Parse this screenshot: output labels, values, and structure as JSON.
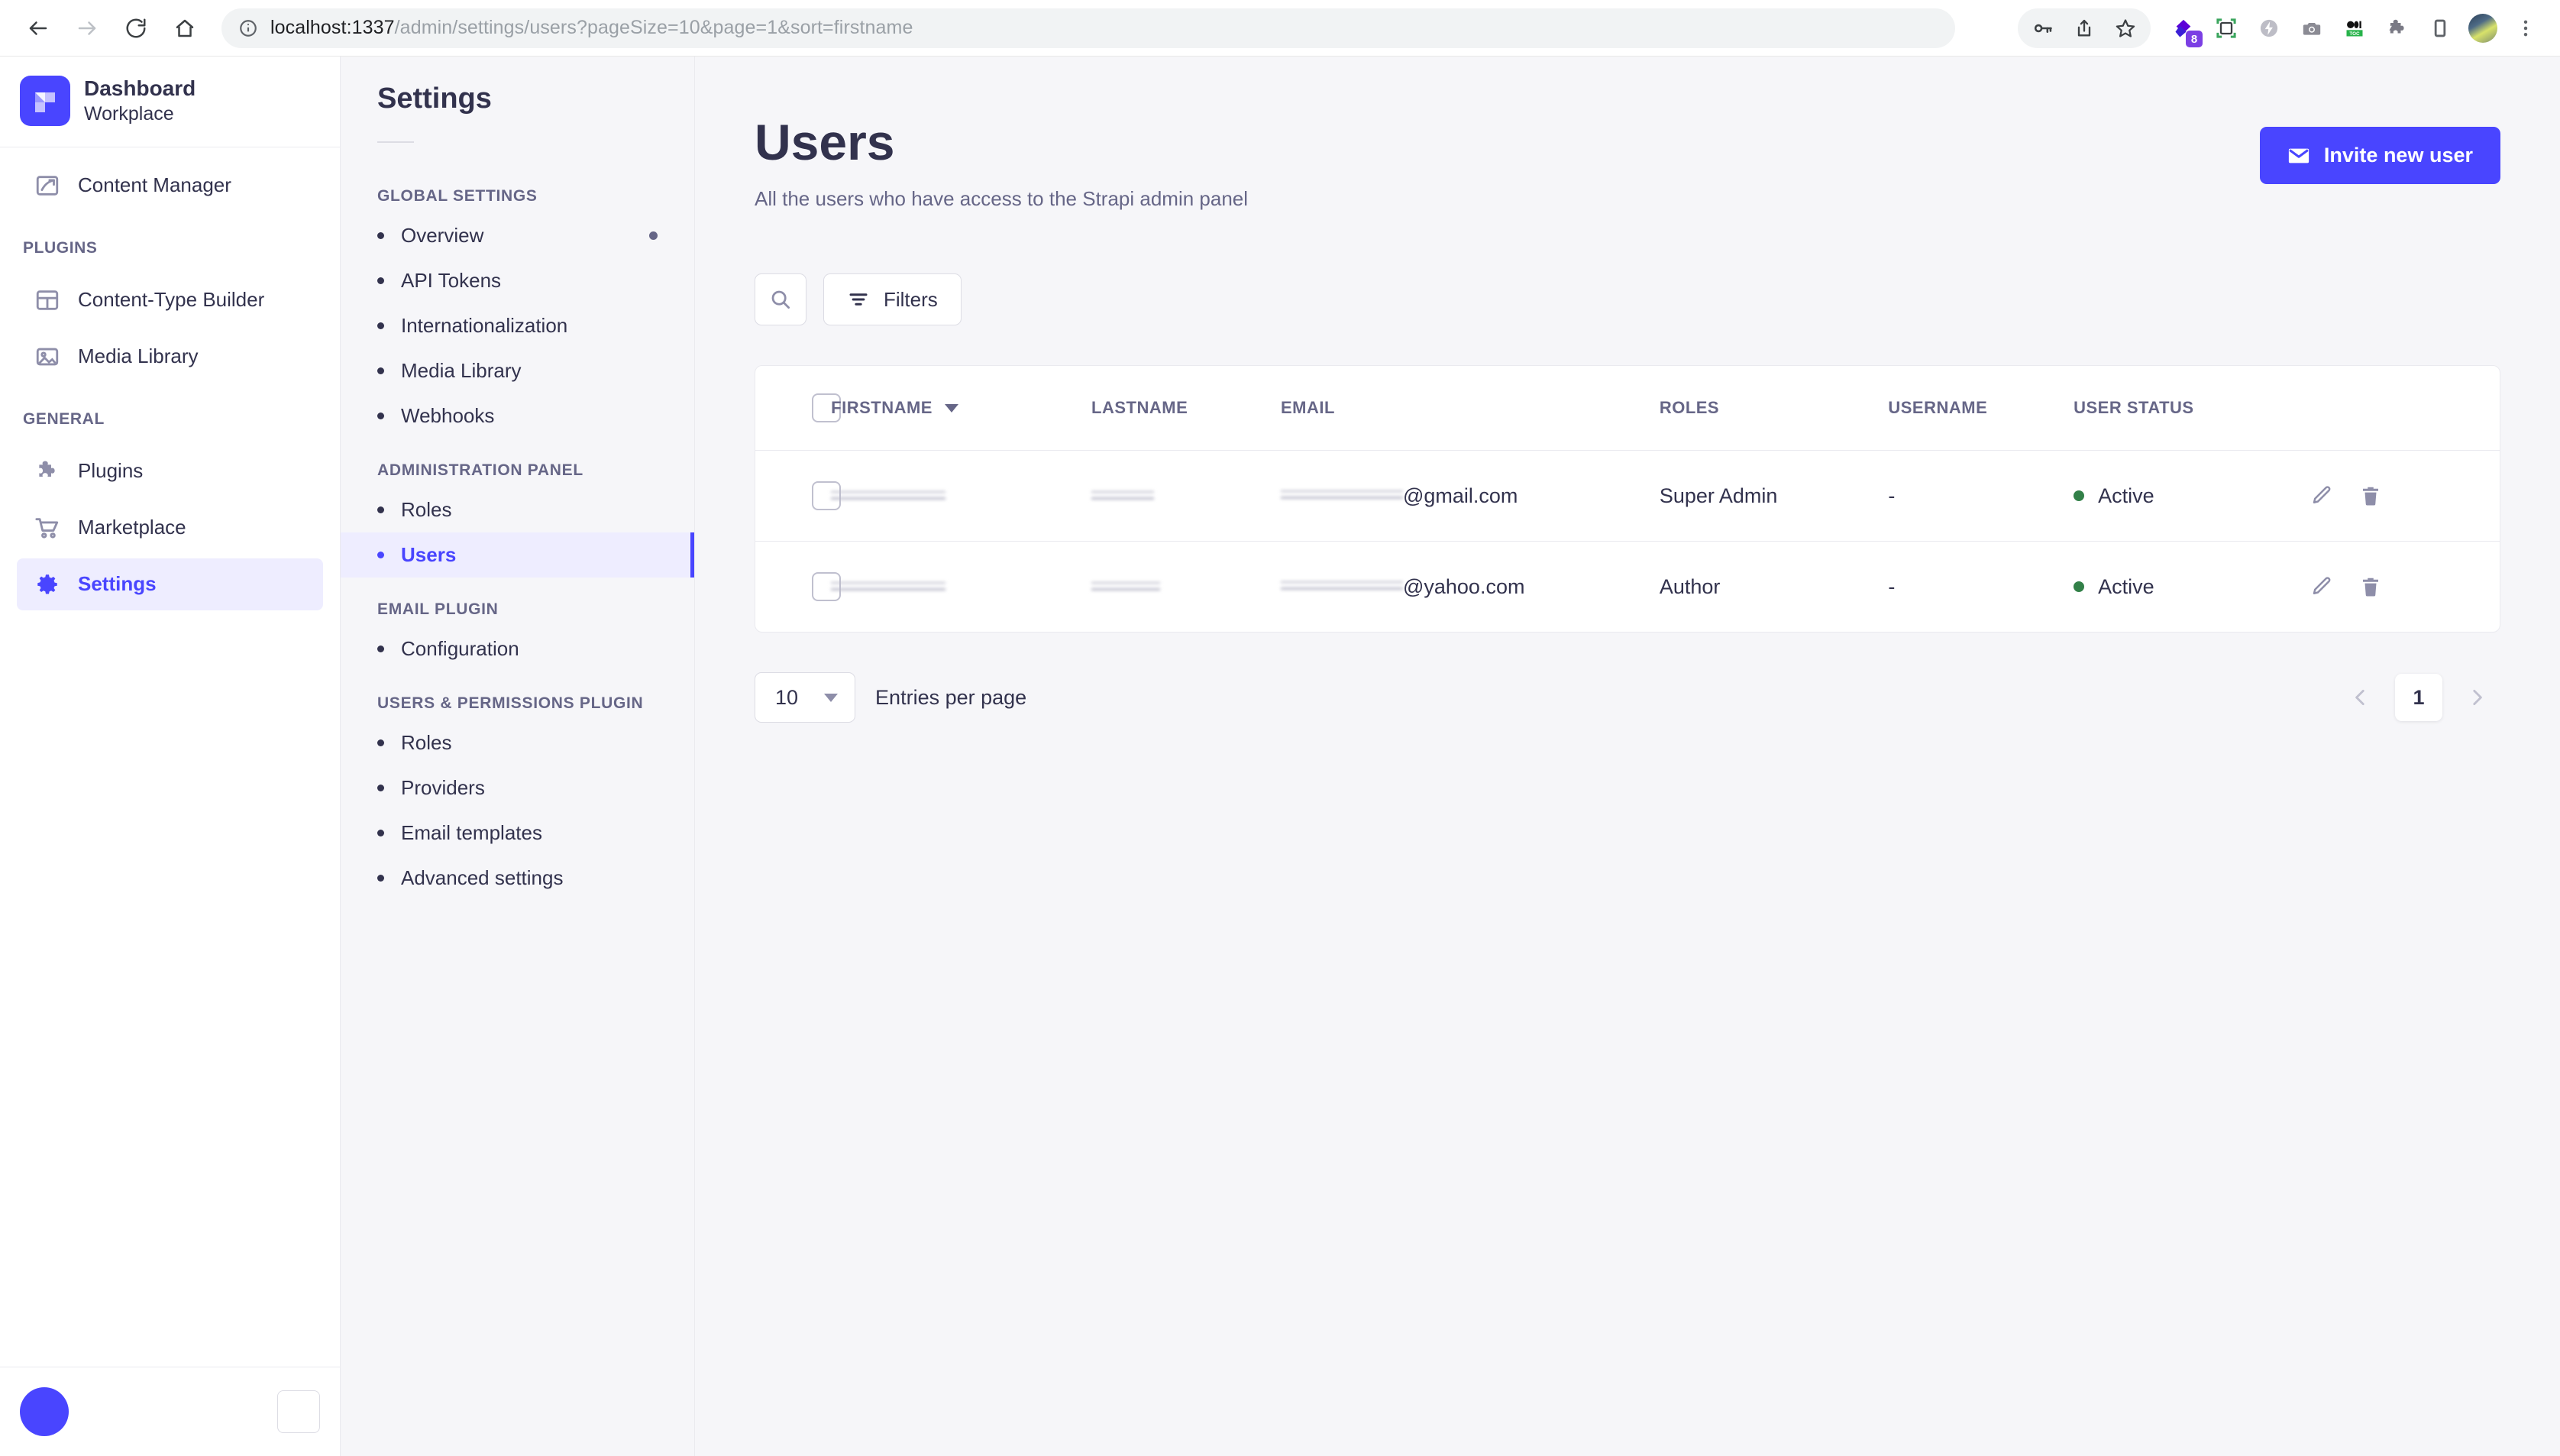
{
  "browser": {
    "url_host": "localhost:1337",
    "url_path": "/admin/settings/users?pageSize=10&page=1&sort=firstname",
    "back_icon": "back-arrow-icon",
    "forward_icon": "forward-arrow-icon",
    "reload_icon": "reload-icon",
    "home_icon": "home-icon",
    "info_icon": "site-info-icon",
    "actions": [
      {
        "name": "password-key-icon",
        "glyph": "key"
      },
      {
        "name": "share-icon",
        "glyph": "share"
      },
      {
        "name": "bookmark-star-icon",
        "glyph": "star"
      },
      {
        "name": "extension-diamond-icon",
        "glyph": "diamond",
        "badge": "8"
      },
      {
        "name": "screen-capture-icon",
        "glyph": "capture"
      },
      {
        "name": "lightning-extension-icon",
        "glyph": "bolt"
      },
      {
        "name": "camera-extension-icon",
        "glyph": "camera"
      },
      {
        "name": "toc-extension-icon",
        "glyph": "toc",
        "label": "TOC"
      },
      {
        "name": "puzzle-extensions-icon",
        "glyph": "puzzle"
      },
      {
        "name": "sidebar-toggle-icon",
        "glyph": "panel"
      },
      {
        "name": "profile-avatar",
        "glyph": "avatar"
      },
      {
        "name": "chrome-menu-icon",
        "glyph": "kebab"
      }
    ]
  },
  "leftnav": {
    "brand": {
      "name": "Dashboard",
      "subtitle": "Workplace",
      "logo": "strapi-logo-icon"
    },
    "items": [
      {
        "label": "Content Manager",
        "icon": "pencil-write-icon",
        "active": false
      },
      {
        "label": "Content-Type Builder",
        "icon": "layout-blocks-icon",
        "active": false
      },
      {
        "label": "Media Library",
        "icon": "image-icon",
        "active": false
      },
      {
        "label": "Plugins",
        "icon": "puzzle-icon",
        "active": false
      },
      {
        "label": "Marketplace",
        "icon": "shopping-cart-icon",
        "active": false
      },
      {
        "label": "Settings",
        "icon": "gear-icon",
        "active": true
      }
    ],
    "section_plugins": "PLUGINS",
    "section_general": "GENERAL"
  },
  "subnav": {
    "title": "Settings",
    "groups": [
      {
        "label": "GLOBAL SETTINGS",
        "items": [
          {
            "label": "Overview",
            "active": false,
            "trailing_dot": true
          },
          {
            "label": "API Tokens",
            "active": false
          },
          {
            "label": "Internationalization",
            "active": false
          },
          {
            "label": "Media Library",
            "active": false
          },
          {
            "label": "Webhooks",
            "active": false
          }
        ]
      },
      {
        "label": "ADMINISTRATION PANEL",
        "items": [
          {
            "label": "Roles",
            "active": false
          },
          {
            "label": "Users",
            "active": true
          }
        ]
      },
      {
        "label": "EMAIL PLUGIN",
        "items": [
          {
            "label": "Configuration",
            "active": false
          }
        ]
      },
      {
        "label": "USERS & PERMISSIONS PLUGIN",
        "items": [
          {
            "label": "Roles",
            "active": false
          },
          {
            "label": "Providers",
            "active": false
          },
          {
            "label": "Email templates",
            "active": false
          },
          {
            "label": "Advanced settings",
            "active": false
          }
        ]
      }
    ]
  },
  "main": {
    "title": "Users",
    "subtitle": "All the users who have access to the Strapi admin panel",
    "invite_button": "Invite new user",
    "invite_icon": "envelope-icon",
    "search_icon": "search-icon",
    "filters_button": "Filters",
    "filters_icon": "filter-icon"
  },
  "table": {
    "columns": [
      {
        "key": "select",
        "label": ""
      },
      {
        "key": "firstname",
        "label": "FIRSTNAME",
        "sorted": true,
        "sort_icon": "sort-descending-caret"
      },
      {
        "key": "lastname",
        "label": "LASTNAME"
      },
      {
        "key": "email",
        "label": "EMAIL"
      },
      {
        "key": "roles",
        "label": "ROLES"
      },
      {
        "key": "username",
        "label": "USERNAME"
      },
      {
        "key": "status",
        "label": "USER STATUS"
      }
    ],
    "rows": [
      {
        "firstname": "",
        "firstname_redacted": true,
        "lastname": "",
        "lastname_redacted": true,
        "email_prefix_redacted": true,
        "email_suffix": "@gmail.com",
        "roles": "Super Admin",
        "username": "-",
        "status": "Active",
        "status_color": "#328048",
        "edit_icon": "pencil-edit-icon",
        "delete_icon": "trash-delete-icon"
      },
      {
        "firstname": "",
        "firstname_redacted": true,
        "lastname": "",
        "lastname_redacted": true,
        "email_prefix_redacted": true,
        "email_suffix": "@yahoo.com",
        "roles": "Author",
        "username": "-",
        "status": "Active",
        "status_color": "#328048",
        "edit_icon": "pencil-edit-icon",
        "delete_icon": "trash-delete-icon"
      }
    ]
  },
  "pagination": {
    "page_size": "10",
    "entries_label": "Entries per page",
    "current_page": "1",
    "prev_icon": "chevron-left-icon",
    "next_icon": "chevron-right-icon"
  },
  "colors": {
    "accent": "#4945ff",
    "accent_soft": "#eeedff",
    "text": "#32324d",
    "muted": "#666687",
    "page_bg": "#f6f6f9",
    "status_active": "#328048"
  }
}
